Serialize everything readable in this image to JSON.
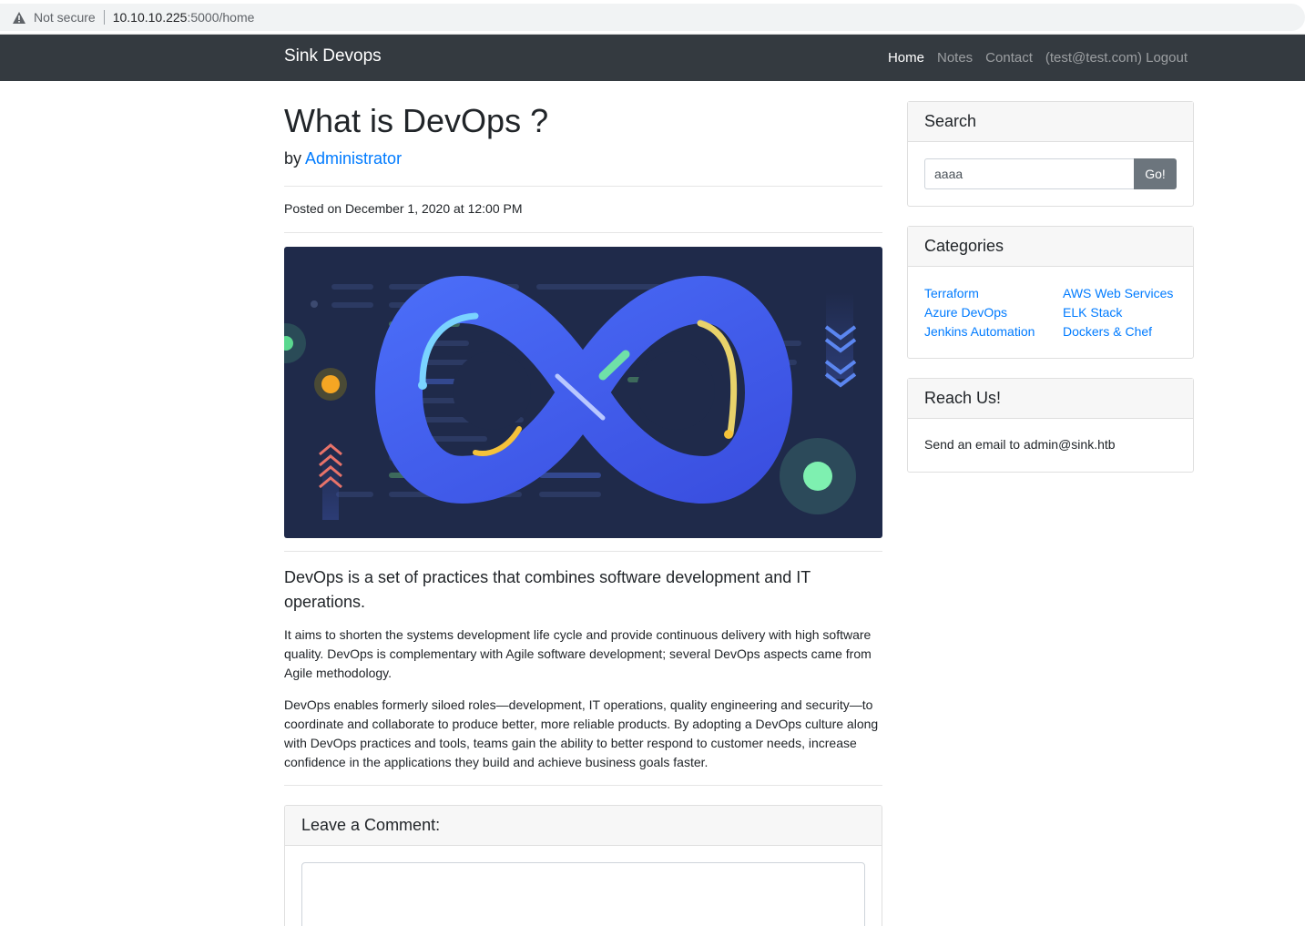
{
  "browser": {
    "security_label": "Not secure",
    "url_host": "10.10.10.225",
    "url_path": ":5000/home"
  },
  "navbar": {
    "brand": "Sink Devops",
    "links": [
      "Home",
      "Notes",
      "Contact",
      "(test@test.com) Logout"
    ],
    "active_index": 0
  },
  "post": {
    "title": "What is DevOps ?",
    "by_prefix": "by",
    "author": "Administrator",
    "posted": "Posted on December 1, 2020 at 12:00 PM",
    "lead": "DevOps is a set of practices that combines software development and IT operations.",
    "paragraphs": [
      "It aims to shorten the systems development life cycle and provide continuous delivery with high software quality. DevOps is complementary with Agile software development; several DevOps aspects came from Agile methodology.",
      "DevOps enables formerly siloed roles—development, IT operations, quality engineering and security—to coordinate and collaborate to produce better, more reliable products. By adopting a DevOps culture along with DevOps practices and tools, teams gain the ability to better respond to customer needs, increase confidence in the applications they build and achieve business goals faster."
    ],
    "hero_image_icon": "devops-infinity-illustration"
  },
  "comment": {
    "header": "Leave a Comment:",
    "value": ""
  },
  "sidebar": {
    "search": {
      "header": "Search",
      "value": "aaaa",
      "button": "Go!"
    },
    "categories": {
      "header": "Categories",
      "left": [
        "Terraform",
        "Azure DevOps",
        "Jenkins Automation"
      ],
      "right": [
        "AWS Web Services",
        "ELK Stack",
        "Dockers & Chef"
      ]
    },
    "reach": {
      "header": "Reach Us!",
      "text": "Send an email to admin@sink.htb"
    }
  },
  "colors": {
    "navbar": "#343a40",
    "link": "#007bff",
    "button": "#6c757d",
    "hero_bg": "#1f2a4a"
  }
}
